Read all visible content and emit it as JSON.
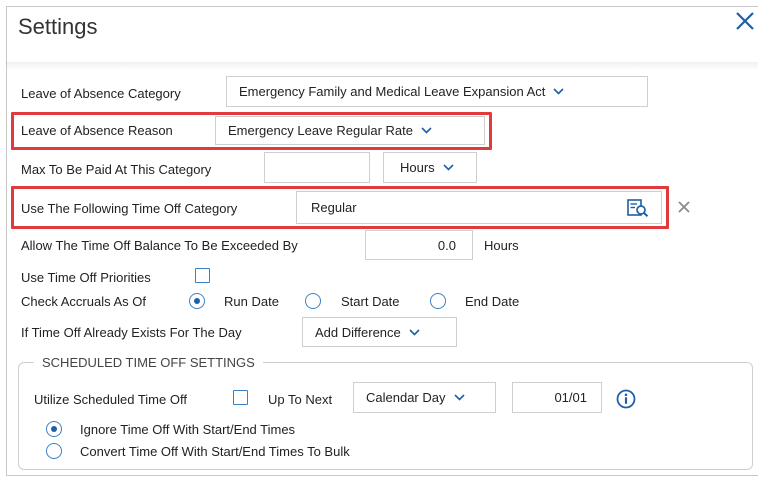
{
  "dialog": {
    "title": "Settings"
  },
  "fields": {
    "loa_category": {
      "label": "Leave of Absence Category",
      "value": "Emergency Family and Medical Leave Expansion Act"
    },
    "loa_reason": {
      "label": "Leave of Absence Reason",
      "value": "Emergency Leave Regular Rate"
    },
    "max_paid": {
      "label": "Max To Be Paid At This Category",
      "value": "",
      "unit": "Hours"
    },
    "time_off_category": {
      "label": "Use The Following Time Off Category",
      "value": "Regular"
    },
    "balance_exceeded": {
      "label": "Allow The Time Off Balance To Be Exceeded By",
      "value": "0.0",
      "unit": "Hours"
    },
    "priorities": {
      "label": "Use Time Off Priorities",
      "checked": false
    },
    "accruals": {
      "label": "Check Accruals As Of",
      "options": [
        "Run Date",
        "Start Date",
        "End Date"
      ],
      "selected": "Run Date"
    },
    "exists": {
      "label": "If Time Off Already Exists For The Day",
      "value": "Add Difference"
    }
  },
  "scheduled": {
    "legend": "SCHEDULED TIME OFF SETTINGS",
    "utilize_label": "Utilize Scheduled Time Off",
    "utilize_checked": false,
    "up_to_next_label": "Up To Next",
    "period": "Calendar Day",
    "date": "01/01",
    "options": [
      "Ignore Time Off With Start/End Times",
      "Convert Time Off With Start/End Times To Bulk"
    ],
    "selected": "Ignore Time Off With Start/End Times"
  },
  "colors": {
    "accent": "#1f5fa8",
    "highlight": "#e0393e"
  },
  "icons": {
    "close": "close-icon",
    "lookup": "lookup-icon",
    "clear": "clear-icon",
    "info": "info-icon",
    "chevron": "chevron-down-icon"
  }
}
